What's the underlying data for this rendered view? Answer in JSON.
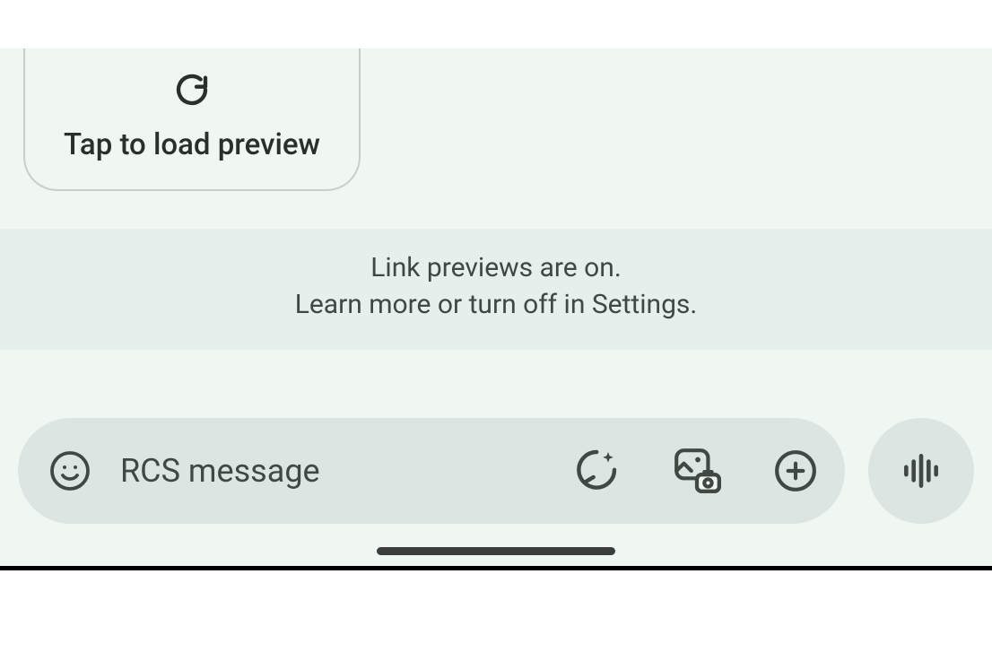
{
  "preview_card": {
    "label": "Tap to load preview"
  },
  "info_banner": {
    "line1": "Link previews are on.",
    "line2": "Learn more or turn off in Settings."
  },
  "composer": {
    "placeholder": "RCS message"
  }
}
